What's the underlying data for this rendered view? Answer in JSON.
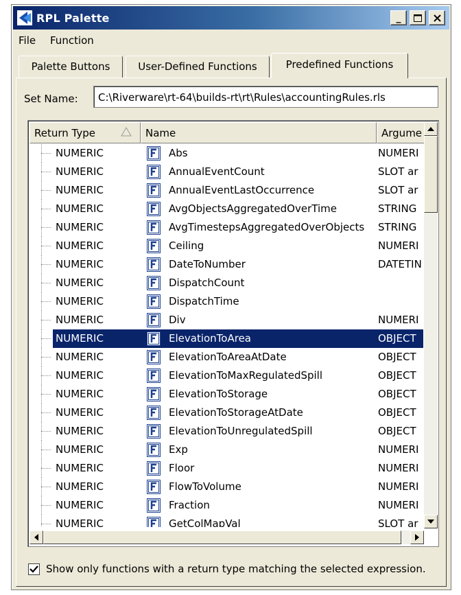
{
  "window": {
    "title": "RPL Palette"
  },
  "menu": {
    "file": "File",
    "function": "Function"
  },
  "tabs": [
    {
      "label": "Palette Buttons"
    },
    {
      "label": "User-Defined Functions"
    },
    {
      "label": "Predefined Functions"
    }
  ],
  "set_name": {
    "label": "Set Name:",
    "value": "C:\\Riverware\\rt-64\\builds-rt\\rt\\Rules\\accountingRules.rls"
  },
  "table": {
    "headers": {
      "return_type": "Return Type",
      "name": "Name",
      "arguments": "Argume"
    },
    "selected_index": 10,
    "rows": [
      {
        "ret": "NUMERIC",
        "name": "Abs",
        "args": "NUMERI"
      },
      {
        "ret": "NUMERIC",
        "name": "AnnualEventCount",
        "args": "SLOT ar"
      },
      {
        "ret": "NUMERIC",
        "name": "AnnualEventLastOccurrence",
        "args": "SLOT ar"
      },
      {
        "ret": "NUMERIC",
        "name": "AvgObjectsAggregatedOverTime",
        "args": "STRING"
      },
      {
        "ret": "NUMERIC",
        "name": "AvgTimestepsAggregatedOverObjects",
        "args": "STRING"
      },
      {
        "ret": "NUMERIC",
        "name": "Ceiling",
        "args": "NUMERI"
      },
      {
        "ret": "NUMERIC",
        "name": "DateToNumber",
        "args": "DATETIN"
      },
      {
        "ret": "NUMERIC",
        "name": "DispatchCount",
        "args": ""
      },
      {
        "ret": "NUMERIC",
        "name": "DispatchTime",
        "args": ""
      },
      {
        "ret": "NUMERIC",
        "name": "Div",
        "args": "NUMERI"
      },
      {
        "ret": "NUMERIC",
        "name": "ElevationToArea",
        "args": "OBJECT"
      },
      {
        "ret": "NUMERIC",
        "name": "ElevationToAreaAtDate",
        "args": "OBJECT"
      },
      {
        "ret": "NUMERIC",
        "name": "ElevationToMaxRegulatedSpill",
        "args": "OBJECT"
      },
      {
        "ret": "NUMERIC",
        "name": "ElevationToStorage",
        "args": "OBJECT"
      },
      {
        "ret": "NUMERIC",
        "name": "ElevationToStorageAtDate",
        "args": "OBJECT"
      },
      {
        "ret": "NUMERIC",
        "name": "ElevationToUnregulatedSpill",
        "args": "OBJECT"
      },
      {
        "ret": "NUMERIC",
        "name": "Exp",
        "args": "NUMERI"
      },
      {
        "ret": "NUMERIC",
        "name": "Floor",
        "args": "NUMERI"
      },
      {
        "ret": "NUMERIC",
        "name": "FlowToVolume",
        "args": "NUMERI"
      },
      {
        "ret": "NUMERIC",
        "name": "Fraction",
        "args": "NUMERI"
      },
      {
        "ret": "NUMERIC",
        "name": "GetColMapVal",
        "args": "SLOT ar"
      }
    ]
  },
  "checkbox": {
    "checked": true,
    "label": "Show only functions with a return type matching the selected expression."
  },
  "icons": {
    "app": "riverware-app-icon",
    "function": "function-f-icon",
    "sort": "sort-triangle-icon"
  },
  "colors": {
    "selection": "#0a246a",
    "titlebar": "#0a246a"
  }
}
